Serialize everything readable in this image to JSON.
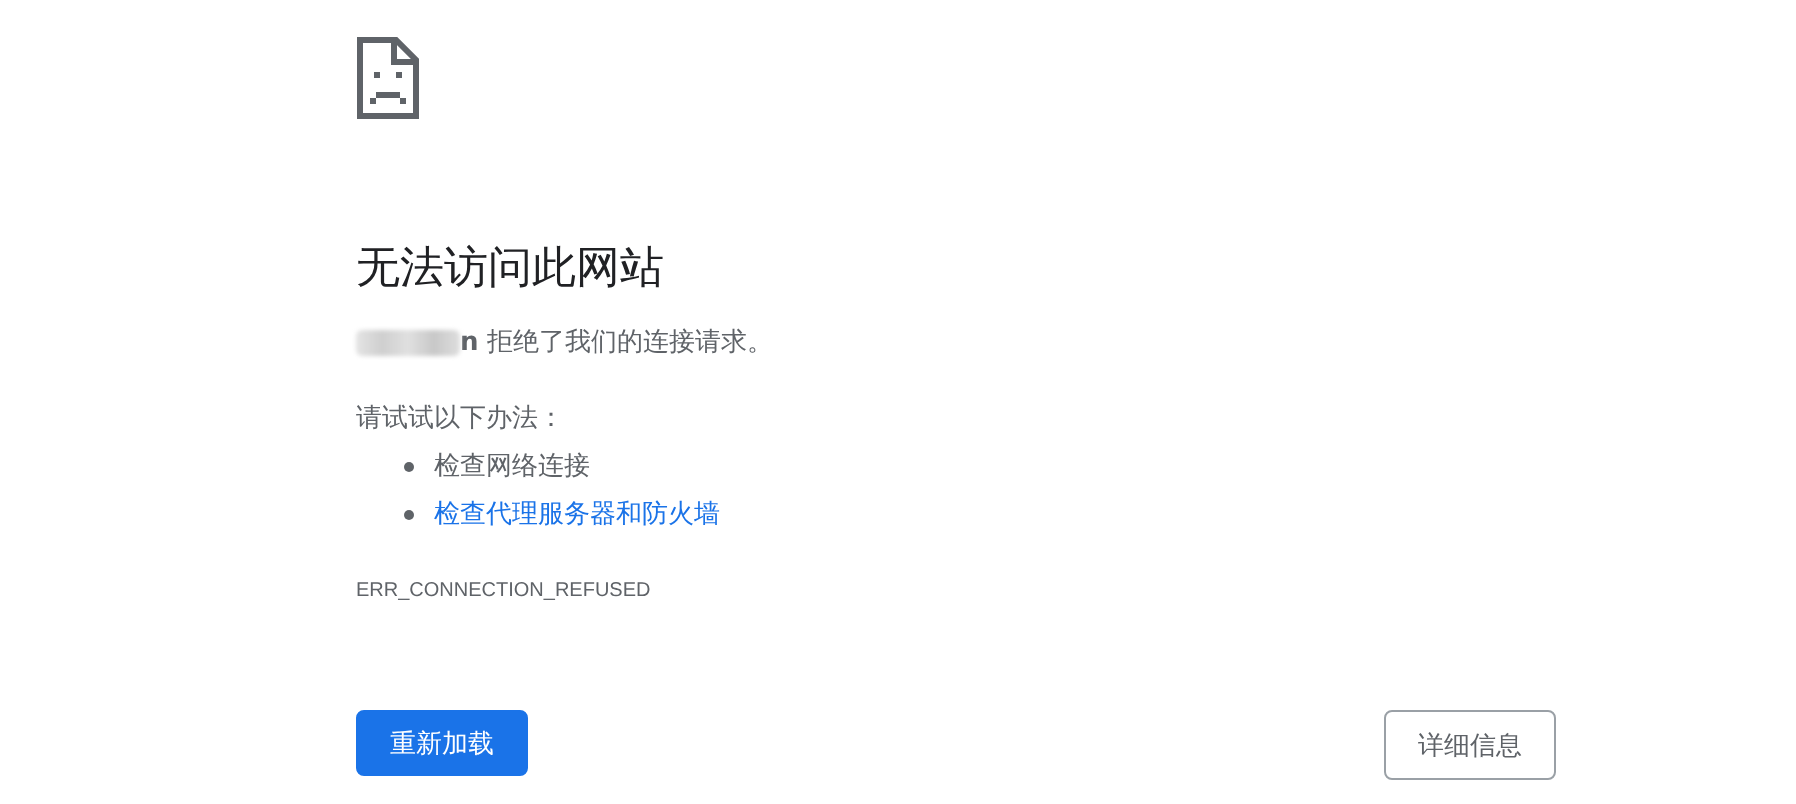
{
  "heading": "无法访问此网站",
  "message": {
    "host_visible": "n",
    "text": "拒绝了我们的连接请求。"
  },
  "suggestions": {
    "intro": "请试试以下办法：",
    "items": [
      {
        "text": "检查网络连接",
        "kind": "plain"
      },
      {
        "text": "检查代理服务器和防火墙",
        "kind": "link"
      }
    ]
  },
  "error_code": "ERR_CONNECTION_REFUSED",
  "buttons": [
    {
      "label": "重新加载",
      "kind": "primary"
    },
    {
      "label": "详细信息",
      "kind": "secondary"
    }
  ]
}
